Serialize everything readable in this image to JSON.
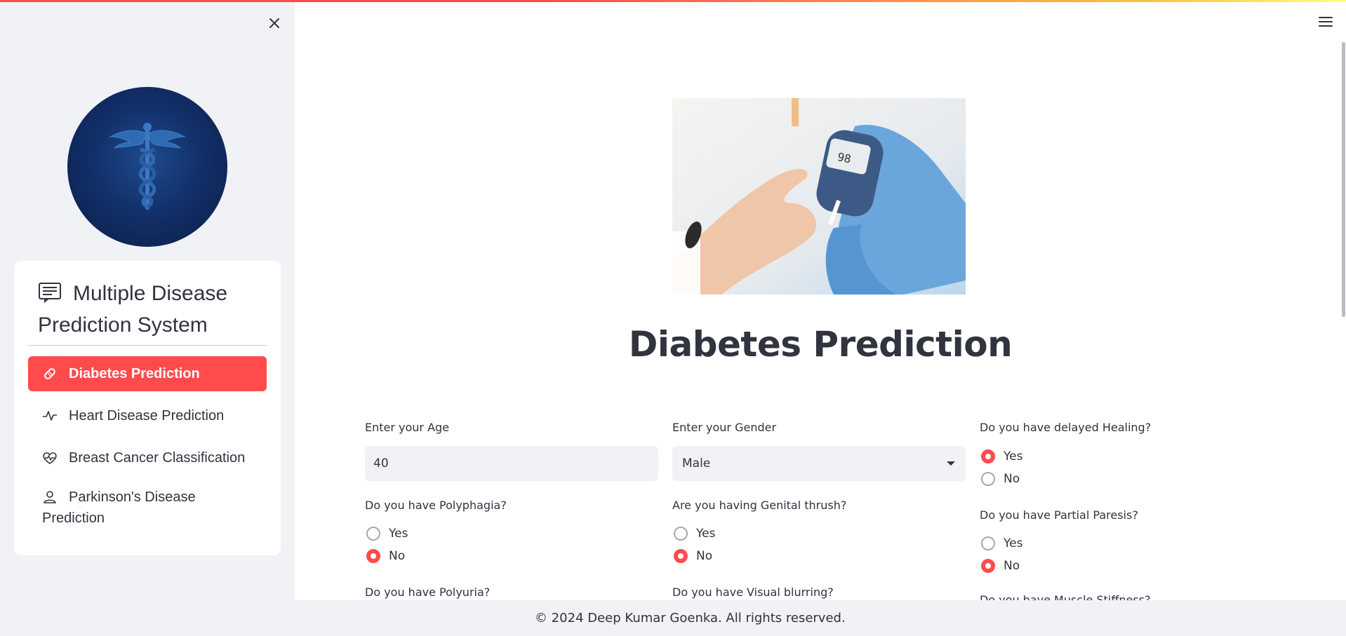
{
  "sidebar": {
    "title": "Multiple Disease Prediction System",
    "items": [
      {
        "label": "Diabetes Prediction",
        "icon": "bandaid-icon",
        "active": true
      },
      {
        "label": "Heart Disease Prediction",
        "icon": "activity-icon",
        "active": false
      },
      {
        "label": "Breast Cancer Classification",
        "icon": "heart-pulse-icon",
        "active": false
      },
      {
        "label": "Parkinson's Disease Prediction",
        "icon": "person-icon",
        "active": false
      }
    ],
    "logo_icon": "caduceus-icon",
    "close_icon": "close-icon"
  },
  "main": {
    "title": "Diabetes Prediction",
    "hero_image": "glucose-meter-photo",
    "form": {
      "age": {
        "label": "Enter your Age",
        "value": "40"
      },
      "gender": {
        "label": "Enter your Gender",
        "value": "Male"
      },
      "delayed_healing": {
        "label": "Do you have delayed Healing?",
        "yes": "Yes",
        "no": "No",
        "selected": "Yes"
      },
      "polyphagia": {
        "label": "Do you have Polyphagia?",
        "yes": "Yes",
        "no": "No",
        "selected": "No"
      },
      "genital_thrush": {
        "label": "Are you having Genital thrush?",
        "yes": "Yes",
        "no": "No",
        "selected": "No"
      },
      "partial_paresis": {
        "label": "Do you have Partial Paresis?",
        "yes": "Yes",
        "no": "No",
        "selected": "No"
      },
      "polyuria": {
        "label": "Do you have Polyuria?"
      },
      "visual_blurring": {
        "label": "Do you have Visual blurring?"
      },
      "muscle_stiffness": {
        "label": "Do you have Muscle Stiffness?"
      }
    }
  },
  "footer": {
    "text": "© 2024 Deep Kumar Goenka. All rights reserved."
  },
  "colors": {
    "accent": "#ff4b4b",
    "sidebar_bg": "#f0f2f6",
    "text": "#31333f"
  }
}
